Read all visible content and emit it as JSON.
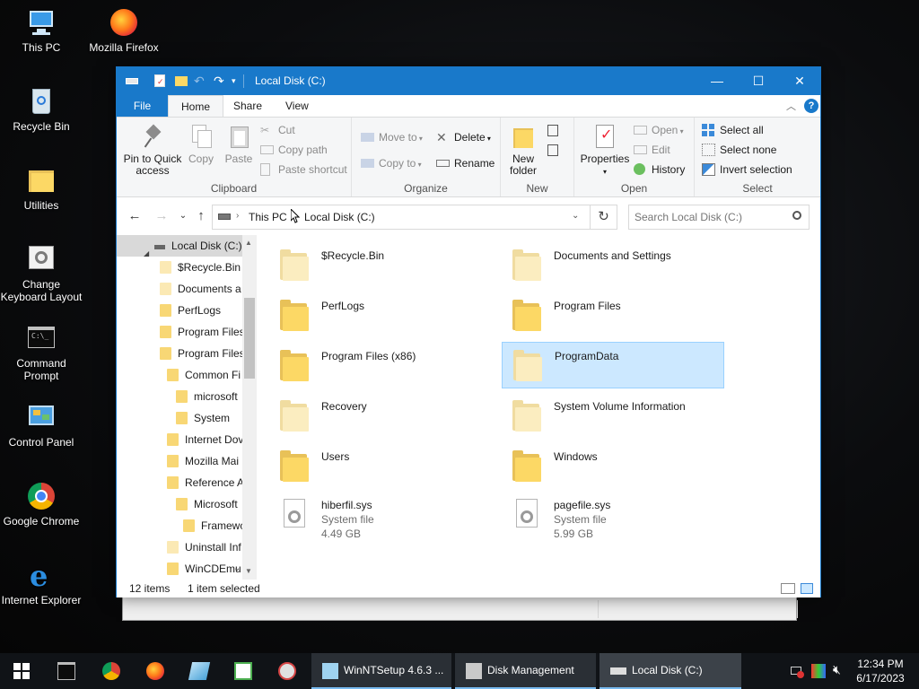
{
  "desktop": {
    "icons": [
      {
        "label": "This PC",
        "icon": "this-pc-icon"
      },
      {
        "label": "Mozilla Firefox",
        "icon": "firefox-icon"
      },
      {
        "label": "Recycle Bin",
        "icon": "recycle-bin-icon"
      },
      {
        "label": "Utilities",
        "icon": "folder-icon"
      },
      {
        "label": "Change Keyboard Layout",
        "icon": "keyboard-icon"
      },
      {
        "label": "Command Prompt",
        "icon": "command-prompt-icon"
      },
      {
        "label": "Control Panel",
        "icon": "control-panel-icon"
      },
      {
        "label": "Google Chrome",
        "icon": "chrome-icon"
      },
      {
        "label": "Internet Explorer",
        "icon": "internet-explorer-icon"
      }
    ]
  },
  "window": {
    "title": "Local Disk (C:)",
    "controls": {
      "minimize": "—",
      "maximize": "☐",
      "close": "✕"
    }
  },
  "ribbon_tabs": {
    "file": "File",
    "home": "Home",
    "share": "Share",
    "view": "View"
  },
  "ribbon": {
    "clipboard": {
      "label": "Clipboard",
      "pin": "Pin to Quick access",
      "copy": "Copy",
      "paste": "Paste",
      "cut": "Cut",
      "copy_path": "Copy path",
      "paste_shortcut": "Paste shortcut"
    },
    "organize": {
      "label": "Organize",
      "move_to": "Move to",
      "copy_to": "Copy to",
      "delete": "Delete",
      "rename": "Rename"
    },
    "new": {
      "label": "New",
      "new_folder": "New folder"
    },
    "open": {
      "label": "Open",
      "properties": "Properties",
      "open": "Open",
      "edit": "Edit",
      "history": "History"
    },
    "select": {
      "label": "Select",
      "select_all": "Select all",
      "select_none": "Select none",
      "invert": "Invert selection"
    }
  },
  "address": {
    "crumbs": [
      "This PC",
      "Local Disk (C:)"
    ],
    "search_placeholder": "Search Local Disk (C:)"
  },
  "navpane": {
    "root": "Local Disk (C:)",
    "items": [
      {
        "label": "$Recycle.Bin",
        "indent": 1,
        "pale": true
      },
      {
        "label": "Documents a",
        "indent": 1,
        "pale": true
      },
      {
        "label": "PerfLogs",
        "indent": 1,
        "pale": false
      },
      {
        "label": "Program Files",
        "indent": 1,
        "pale": false
      },
      {
        "label": "Program Files",
        "indent": 1,
        "pale": false
      },
      {
        "label": "Common Fi",
        "indent": 2,
        "pale": false
      },
      {
        "label": "microsoft",
        "indent": 3,
        "pale": false
      },
      {
        "label": "System",
        "indent": 3,
        "pale": false
      },
      {
        "label": "Internet Dov",
        "indent": 2,
        "pale": false
      },
      {
        "label": "Mozilla Mai",
        "indent": 2,
        "pale": false
      },
      {
        "label": "Reference A",
        "indent": 2,
        "pale": false
      },
      {
        "label": "Microsoft",
        "indent": 3,
        "pale": false
      },
      {
        "label": "Framewc",
        "indent": 4,
        "pale": false
      },
      {
        "label": "Uninstall Inf",
        "indent": 2,
        "pale": true
      },
      {
        "label": "WinCDEmu",
        "indent": 2,
        "pale": false
      }
    ]
  },
  "files": [
    {
      "name": "$Recycle.Bin",
      "kind": "folder",
      "pale": true,
      "selected": false
    },
    {
      "name": "Documents and Settings",
      "kind": "folder",
      "pale": true,
      "selected": false
    },
    {
      "name": "PerfLogs",
      "kind": "folder",
      "pale": false,
      "selected": false
    },
    {
      "name": "Program Files",
      "kind": "folder",
      "pale": false,
      "selected": false
    },
    {
      "name": "Program Files (x86)",
      "kind": "folder",
      "pale": false,
      "selected": false
    },
    {
      "name": "ProgramData",
      "kind": "folder",
      "pale": true,
      "selected": true
    },
    {
      "name": "Recovery",
      "kind": "folder",
      "pale": true,
      "selected": false
    },
    {
      "name": "System Volume Information",
      "kind": "folder",
      "pale": true,
      "selected": false
    },
    {
      "name": "Users",
      "kind": "folder",
      "pale": false,
      "selected": false
    },
    {
      "name": "Windows",
      "kind": "folder",
      "pale": false,
      "selected": false
    },
    {
      "name": "hiberfil.sys",
      "kind": "sysfile",
      "type": "System file",
      "size": "4.49 GB",
      "selected": false
    },
    {
      "name": "pagefile.sys",
      "kind": "sysfile",
      "type": "System file",
      "size": "5.99 GB",
      "selected": false
    }
  ],
  "status": {
    "count": "12 items",
    "selected": "1 item selected"
  },
  "taskbar": {
    "tasks": [
      {
        "label": "WinNTSetup 4.6.3 ...",
        "active": false
      },
      {
        "label": "Disk Management",
        "active": false
      },
      {
        "label": "Local Disk (C:)",
        "active": true
      }
    ],
    "time": "12:34 PM",
    "date": "6/17/2023"
  },
  "colors": {
    "accent": "#1979ca",
    "selection": "#cce8ff",
    "folder": "#fcd865"
  }
}
